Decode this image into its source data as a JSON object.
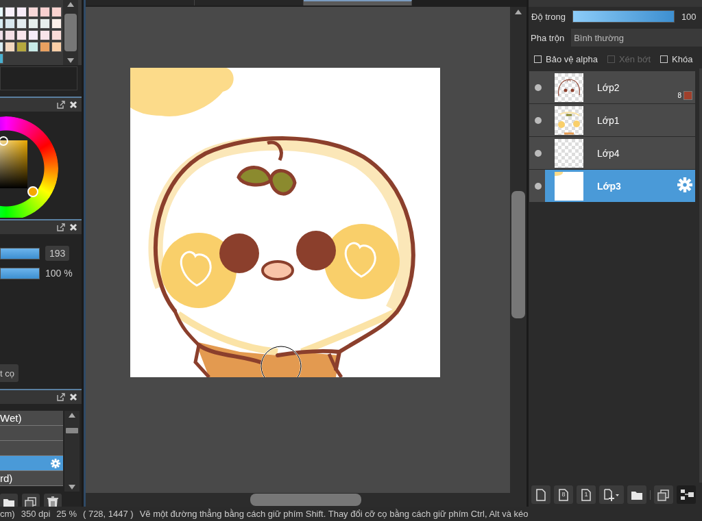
{
  "document_tabs": [
    {
      "selected": false
    },
    {
      "selected": false
    },
    {
      "selected": true
    }
  ],
  "palette": {
    "swatches": [
      {
        "color": "#e6f7fb"
      },
      {
        "color": "#f8f0fa"
      },
      {
        "color": "#f7ecf8"
      },
      {
        "color": "#f7d8d8"
      },
      {
        "color": "#f8d0d0"
      },
      {
        "color": "#f9d3d0"
      },
      {
        "color": "#d8eef4"
      },
      {
        "color": "#d8e8ee"
      },
      {
        "color": "#e3ecef"
      },
      {
        "color": "#e6efec"
      },
      {
        "color": "#e7eeec"
      },
      {
        "color": "#fdf0ea"
      },
      {
        "color": "#f0e0ea"
      },
      {
        "color": "#f4e0e6"
      },
      {
        "color": "#f8e6ec"
      },
      {
        "color": "#f5ecf8"
      },
      {
        "color": "#f7e4ea"
      },
      {
        "color": "#f9dcd8"
      },
      {
        "color": "#d8eef4"
      },
      {
        "color": "#f2d8c0"
      },
      {
        "color": "#b5a83e"
      },
      {
        "color": "#c8ebe8"
      },
      {
        "color": "#e8a060"
      },
      {
        "color": "#fbcfa8"
      },
      {
        "color": "#48b0d0"
      }
    ]
  },
  "brush_settings": {
    "size": {
      "level": 1,
      "value": "193"
    },
    "opacity": {
      "level": 1,
      "value": "100 %"
    },
    "button": "t cọ"
  },
  "brush_list": {
    "items": [
      {
        "label": "Wet)",
        "selected": false
      },
      {
        "selected": false
      },
      {
        "selected": false
      },
      {
        "selected": true
      },
      {
        "label": "rd)",
        "selected": false
      }
    ],
    "toolbar": [
      {
        "kind": "folder"
      },
      {
        "kind": "duplicate"
      },
      {
        "kind": "delete"
      }
    ]
  },
  "layer_panel": {
    "opacity_label": "Độ trong",
    "opacity": {
      "level": 1,
      "value": "100"
    },
    "blend_label": "Pha trộn",
    "blend_value": "Bình thường",
    "options": [
      {
        "label": "Bảo vệ alpha",
        "checked": false,
        "disabled": false
      },
      {
        "label": "Xén bớt",
        "checked": false,
        "disabled": true
      },
      {
        "label": "Khóa",
        "checked": false,
        "disabled": false
      }
    ],
    "layers": [
      {
        "name": "Lớp2",
        "kind": "line-art",
        "selected": false,
        "badge": "8"
      },
      {
        "name": "Lớp1",
        "kind": "color",
        "selected": false
      },
      {
        "name": "Lớp4",
        "kind": "empty",
        "selected": false
      },
      {
        "name": "Lớp3",
        "kind": "fill",
        "selected": true
      }
    ],
    "toolbar": [
      {
        "kind": "new"
      },
      {
        "kind": "new",
        "glyph": "8"
      },
      {
        "kind": "new",
        "glyph": "1"
      },
      {
        "kind": "add-menu"
      },
      {
        "kind": "folder"
      },
      {
        "kind": "duplicate"
      },
      {
        "kind": "merge"
      }
    ]
  },
  "status_bar": {
    "unit": "cm)",
    "dpi": "350 dpi",
    "zoom": "25 %",
    "coords": "( 728, 1447 )",
    "hint": "Vẽ một đường thẳng bằng cách giữ phím Shift. Thay đổi cỡ cọ bằng cách giữ phím Ctrl, Alt và kéo"
  }
}
